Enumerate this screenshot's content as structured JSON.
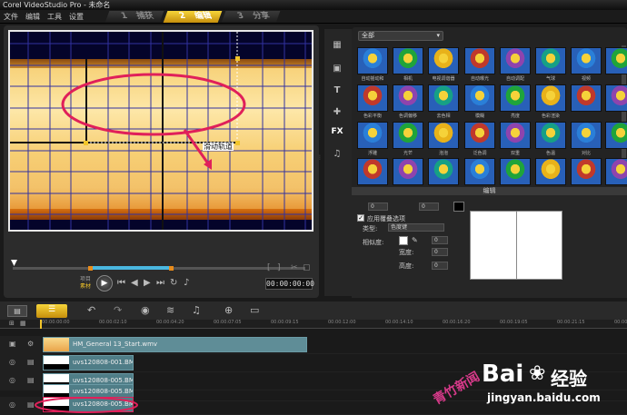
{
  "app": {
    "title": "Corel VideoStudio Pro - 未命名"
  },
  "menu": [
    "文件",
    "编辑",
    "工具",
    "设置"
  ],
  "steps": [
    {
      "num": "1",
      "label": "捕获"
    },
    {
      "num": "2",
      "label": "编辑"
    },
    {
      "num": "3",
      "label": "分享"
    }
  ],
  "preview": {
    "annotation": "滑动轨道",
    "mode_project": "项目",
    "mode_clip": "素材",
    "timecode": "00:00:00:00"
  },
  "library": {
    "category": "全部",
    "thumb_labels": [
      [
        "自动摇动和",
        "相机",
        "电视调谐器",
        "自动曝光",
        "自动调配",
        "气球",
        "视频",
        ""
      ],
      [
        "色彩平衡",
        "色调偏移",
        "去色相",
        "模糊",
        "亮度",
        "色彩渲染",
        "",
        ""
      ],
      [
        "浮雕",
        "光芒",
        "泡泡",
        "泛色调",
        "双重",
        "色温",
        "对比",
        ""
      ],
      [
        "",
        "",
        "",
        "",
        "",
        "",
        "",
        ""
      ]
    ]
  },
  "options": {
    "header": "编辑",
    "field1": "0",
    "field2": "0",
    "checkbox_label": "应用覆叠选项",
    "type_label": "类型:",
    "type_value": "色度键",
    "similarity_label": "相似度:",
    "similarity_value": "0",
    "width_label": "宽度:",
    "width_value": "0",
    "height_label": "高度:",
    "height_value": "0"
  },
  "ruler": [
    "00:00:00:00",
    "00:00:02:10",
    "00:00:04:20",
    "00:00:07:05",
    "00:00:09:15",
    "00:00:12:00",
    "00:00:14:10",
    "00:00:16:20",
    "00:00:19:05",
    "00:00:21:15",
    "00:00:24:00"
  ],
  "tracks": [
    {
      "clip": "HM_General 13_Start.wmv"
    },
    {
      "clip": "uvs120808-001.BMP"
    },
    {
      "clip": "uvs120808-005.BMP"
    },
    {
      "clip": "uvs120808-005.BMP"
    },
    {
      "clip": "uvs120808-005.BMP"
    }
  ],
  "watermark": {
    "brand": "Bai",
    "brand_tail": "经验",
    "url": "jingyan.baidu.com",
    "side_text": "青竹新闻"
  },
  "colors": {
    "accent": "#f2c52a",
    "clip": "#4f7d87",
    "annotation": "#e0205a",
    "grid": "#3232a0"
  }
}
